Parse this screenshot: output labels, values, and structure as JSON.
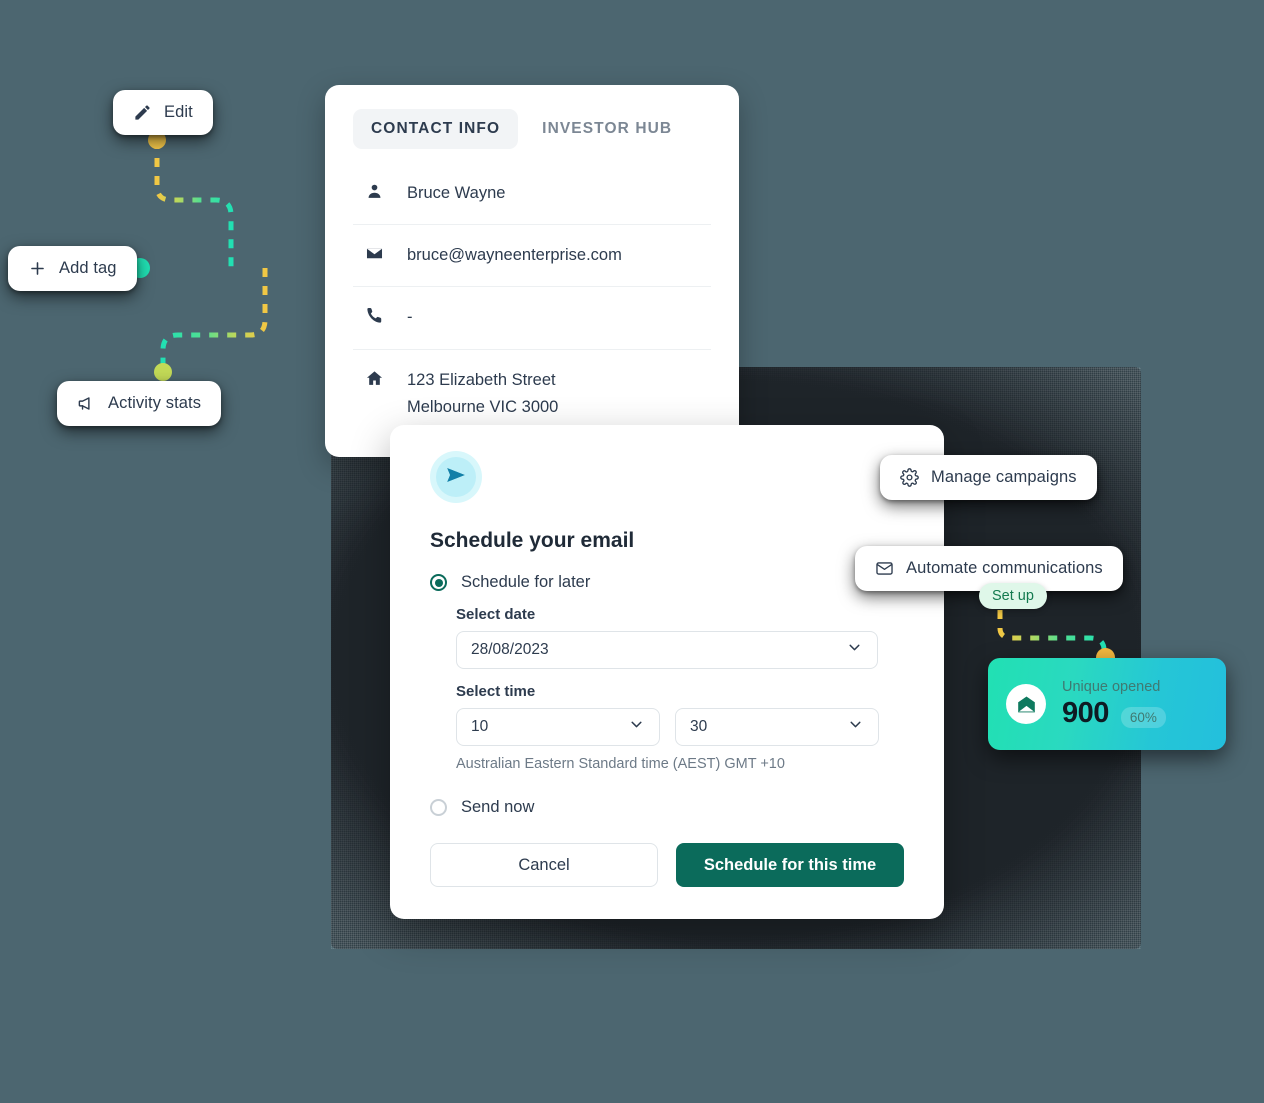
{
  "canvas": {
    "background_color": "#4c6670",
    "backdrop_color": "#1d2227"
  },
  "flow_buttons": [
    {
      "id": "edit",
      "label": "Edit",
      "icon": "pencil-icon"
    },
    {
      "id": "add-tag",
      "label": "Add tag",
      "icon": "plus-icon"
    },
    {
      "id": "activity",
      "label": "Activity stats",
      "icon": "megaphone-icon"
    },
    {
      "id": "manage",
      "label": "Manage campaigns",
      "icon": "gear-icon"
    },
    {
      "id": "automate",
      "label": "Automate communications",
      "icon": "envelope-icon"
    }
  ],
  "connectors": {
    "colors": {
      "yellow": "#f2c744",
      "green": "#8fd46a",
      "teal": "#21e0b3"
    },
    "node_colors": {
      "edit_dot": "#f5c84a",
      "add_tag_dot": "#21e0b3",
      "activity_dot": "#c3da57",
      "stat_dot": "#f5b93f"
    }
  },
  "contact_card": {
    "tabs": [
      {
        "label": "CONTACT INFO",
        "active": true
      },
      {
        "label": "INVESTOR HUB",
        "active": false
      }
    ],
    "rows": [
      {
        "icon": "person-icon",
        "value": "Bruce Wayne"
      },
      {
        "icon": "envelope-icon",
        "value": "bruce@wayneenterprise.com"
      },
      {
        "icon": "phone-icon",
        "value": "-"
      },
      {
        "icon": "home-icon",
        "value": "123 Elizabeth Street\nMelbourne VIC 3000"
      }
    ],
    "address_line1": "123 Elizabeth Street",
    "address_line2": "Melbourne VIC 3000"
  },
  "schedule_dialog": {
    "logo_icon": "paper-plane-icon",
    "title": "Schedule your email",
    "option_later": {
      "label": "Schedule for later",
      "selected": true
    },
    "option_now": {
      "label": "Send now",
      "selected": false
    },
    "date_label": "Select date",
    "date_value": "28/08/2023",
    "time_label": "Select time",
    "hour_value": "10",
    "minute_value": "30",
    "timezone_note": "Australian Eastern Standard time (AEST) GMT +10",
    "cancel_label": "Cancel",
    "submit_label": "Schedule for this time",
    "accent_color": "#0b6b5b"
  },
  "setup_badge": {
    "label": "Set up",
    "bg": "#dff7e9",
    "fg": "#137a4f"
  },
  "stat_card": {
    "icon": "open-envelope-icon",
    "label": "Unique opened",
    "value": "900",
    "percent": "60%",
    "gradient_from": "#21e0b3",
    "gradient_to": "#23bfdd"
  }
}
